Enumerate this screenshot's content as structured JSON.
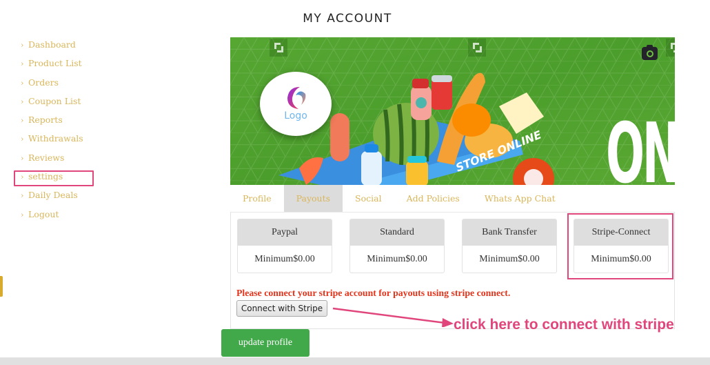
{
  "page": {
    "title": "MY ACCOUNT"
  },
  "sidebar": {
    "items": [
      {
        "label": "Dashboard"
      },
      {
        "label": "Product List"
      },
      {
        "label": "Orders"
      },
      {
        "label": "Coupon List"
      },
      {
        "label": "Reports"
      },
      {
        "label": "Withdrawals"
      },
      {
        "label": "Reviews"
      },
      {
        "label": "settings",
        "highlighted": true
      },
      {
        "label": "Daily Deals"
      },
      {
        "label": "Logout"
      }
    ],
    "chevron": "›"
  },
  "banner": {
    "logo_text": "Logo",
    "banner_text": "ON",
    "store_text": "STORE ONLINE",
    "icons": [
      "camera-icon",
      "crop-icon"
    ]
  },
  "tabs": [
    {
      "label": "Profile",
      "active": false
    },
    {
      "label": "Payouts",
      "active": true
    },
    {
      "label": "Social",
      "active": false
    },
    {
      "label": "Add Policies",
      "active": false
    },
    {
      "label": "Whats App Chat",
      "active": false
    }
  ],
  "payouts": {
    "methods": [
      {
        "name": "Paypal",
        "minimum": "Minimum$0.00"
      },
      {
        "name": "Standard",
        "minimum": "Minimum$0.00"
      },
      {
        "name": "Bank Transfer",
        "minimum": "Minimum$0.00"
      },
      {
        "name": "Stripe-Connect",
        "minimum": "Minimum$0.00",
        "highlighted": true
      }
    ],
    "notice": "Please connect your stripe account for payouts using stripe connect.",
    "connect_button": "Connect with Stripe"
  },
  "annotation": {
    "text": "click here to connect with stripe",
    "color": "#e0457b"
  },
  "actions": {
    "update_profile": "update profile"
  },
  "colors": {
    "sidebar_link": "#d9b65a",
    "highlight": "#e0457b",
    "notice": "#e2331b",
    "update_button": "#41a94a",
    "banner_green": "#4c9e2c"
  }
}
